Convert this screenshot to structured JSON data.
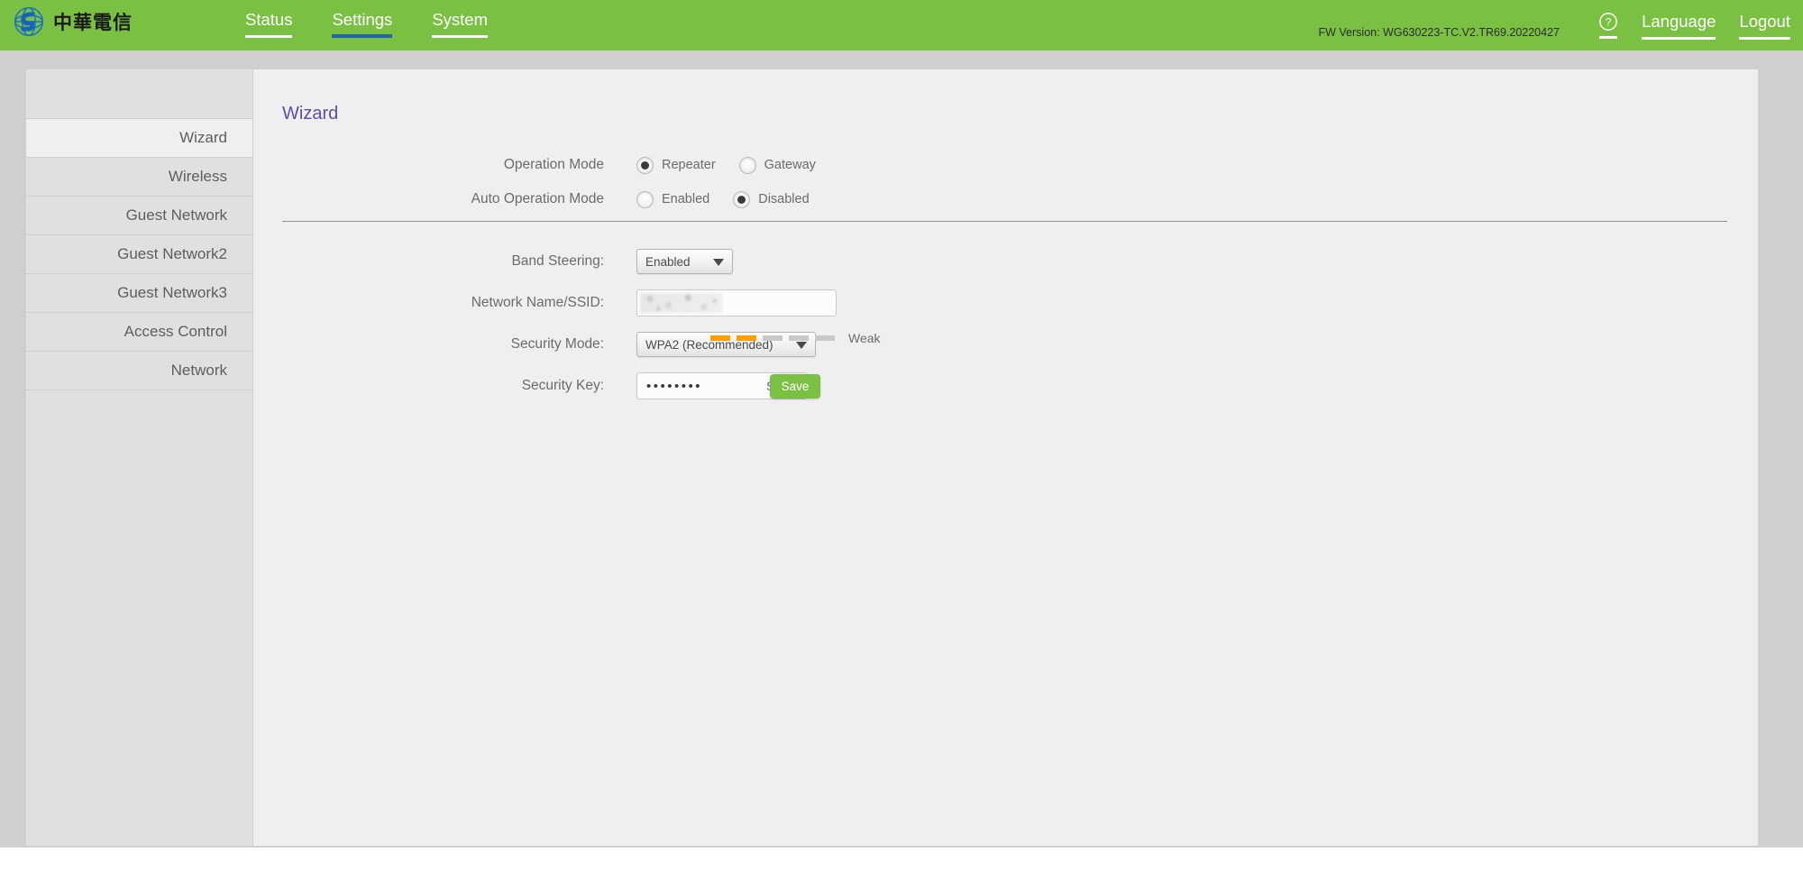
{
  "header": {
    "brand_text": "中華電信",
    "brand_logo_icon": "globe-spiral-icon",
    "nav": [
      {
        "label": "Status",
        "active": false
      },
      {
        "label": "Settings",
        "active": true
      },
      {
        "label": "System",
        "active": false
      }
    ],
    "fw_version": "FW Version: WG630223-TC.V2.TR69.20220427",
    "help_icon": "question-circle-icon",
    "language_label": "Language",
    "logout_label": "Logout",
    "accent_green": "#7ac143",
    "active_tab_underline": "#2663ad"
  },
  "sidebar": {
    "items": [
      {
        "label": "Wizard",
        "active": true
      },
      {
        "label": "Wireless",
        "active": false
      },
      {
        "label": "Guest Network",
        "active": false
      },
      {
        "label": "Guest Network2",
        "active": false
      },
      {
        "label": "Guest Network3",
        "active": false
      },
      {
        "label": "Access Control",
        "active": false
      },
      {
        "label": "Network",
        "active": false
      }
    ]
  },
  "main": {
    "page_title": "Wizard",
    "title_color": "#5b4fa8",
    "operation_mode": {
      "label": "Operation Mode",
      "options": [
        {
          "label": "Repeater",
          "selected": true
        },
        {
          "label": "Gateway",
          "selected": false
        }
      ]
    },
    "auto_operation_mode": {
      "label": "Auto Operation Mode",
      "options": [
        {
          "label": "Enabled",
          "selected": false
        },
        {
          "label": "Disabled",
          "selected": true
        }
      ]
    },
    "band_steering": {
      "label": "Band Steering:",
      "value": "Enabled",
      "caret_icon": "chevron-down-icon"
    },
    "ssid": {
      "label": "Network Name/SSID:",
      "value": "",
      "redacted": true
    },
    "security_mode": {
      "label": "Security Mode:",
      "value": "WPA2 (Recommended)",
      "caret_icon": "chevron-down-icon"
    },
    "security_key": {
      "label": "Security Key:",
      "masked_value": "••••••••",
      "show_label": "Show",
      "show_link_color": "#7b4fd0"
    },
    "strength": {
      "label": "Weak",
      "filled": 2,
      "total": 5,
      "fill_color": "#ffa000",
      "empty_color": "#c9c9c9"
    },
    "save_label": "Save"
  }
}
